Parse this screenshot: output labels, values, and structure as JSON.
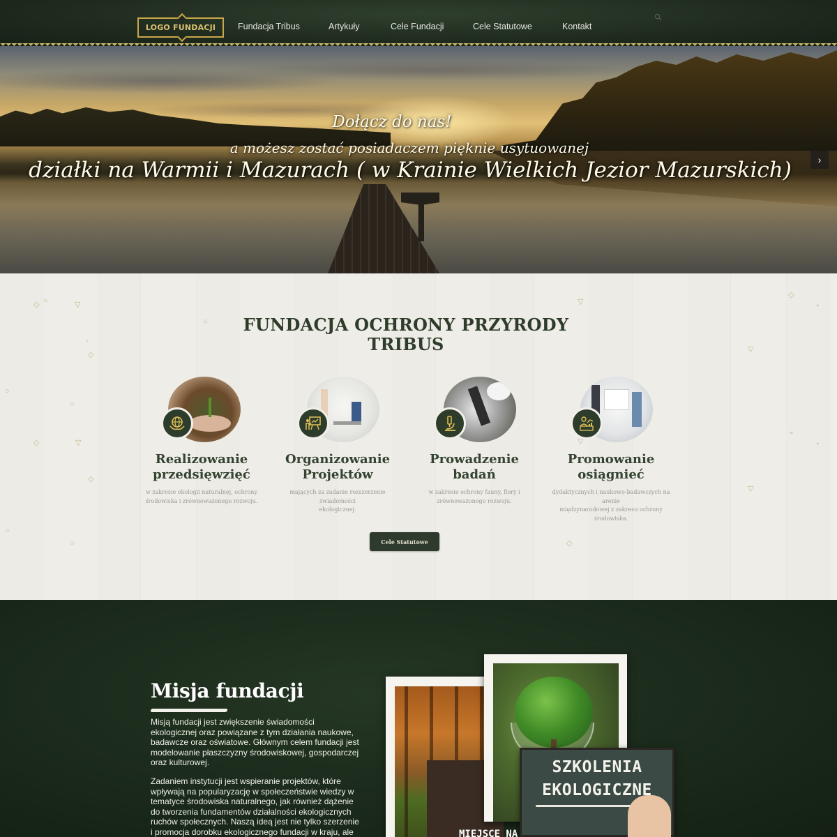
{
  "nav": {
    "logo": "LOGO FUNDACJI",
    "items": [
      "Fundacja Tribus",
      "Artykuły",
      "Cele Fundacji",
      "Cele Statutowe",
      "Kontakt"
    ],
    "search_icon": "search-icon"
  },
  "hero": {
    "line1": "Dołącz do nas!",
    "line2": "a możesz zostać posiadaczem pięknie usytuowanej",
    "line3": "działki na Warmii i Mazurach ( w Krainie Wielkich Jezior Mazurskich)",
    "next_icon": "chevron-right-icon"
  },
  "intro": {
    "title_line1": "FUNDACJA OCHRONY PRZYRODY",
    "title_line2": "TRIBUS",
    "features": [
      {
        "title1": "Realizowanie",
        "title2": "przedsięwzięć",
        "text1": "w zakresie ekologii naturalnej, ochrony",
        "text2": "środowiska i zrównoważonego rozwoju.",
        "text3": "",
        "icon": "globe-hands-icon"
      },
      {
        "title1": "Organizowanie",
        "title2": "Projektów",
        "text1": "mających za zadanie rozszerzenie świadomości",
        "text2": "ekologicznej.",
        "text3": "",
        "icon": "presentation-icon"
      },
      {
        "title1": "Prowadzenie",
        "title2": "badań",
        "text1": "w zakresie ochrony fauny, flory i",
        "text2": "zrównoważonego rozwoju.",
        "text3": "",
        "icon": "microscope-icon"
      },
      {
        "title1": "Promowanie",
        "title2": "osiągnieć",
        "text1": "dydaktycznych i naukowo-badawczych na arenie",
        "text2": "międzynarodowej z zakresu ochrony",
        "text3": "środowiska.",
        "icon": "growth-chart-icon"
      }
    ],
    "cta": "Cele Statutowe"
  },
  "mission": {
    "title": "Misja fundacji",
    "p1": "Misją fundacji jest zwiększenie świadomości ekologicznej oraz powiązane z tym działania naukowe, badawcze oraz oświatowe. Głównym celem fundacji jest modelowanie płaszczyzny środowiskowej, gospodarczej oraz kulturowej.",
    "p2": "Zadaniem instytucji jest wspieranie projektów, które wpływają na popularyzację w społeczeństwie wiedzy w tematyce środowiska naturalnego, jak również dążenie do tworzenia fundamentów działalności ekologicznych ruchów społecznych. Naszą ideą jest nie tylko szerzenie i promocja dorobku ekologicznego fundacji w kraju, ale",
    "board_text": "MIEJSCE NA",
    "chalk1": "SZKOLENIA",
    "chalk2": "EKOLOGICZNE"
  }
}
